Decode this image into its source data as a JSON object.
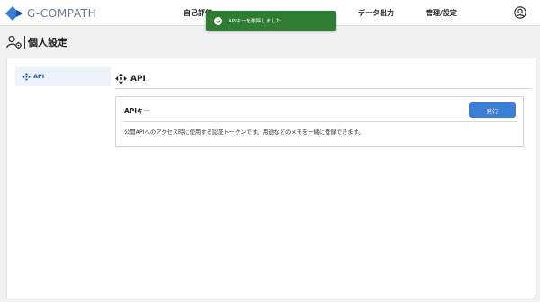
{
  "app": {
    "logo_text": "G-COMPATH"
  },
  "nav": {
    "items": [
      {
        "label": "自己評価"
      },
      {
        "label": "データ出力"
      },
      {
        "label": "管理/設定"
      }
    ]
  },
  "toast": {
    "message": "APIキーを削除しました",
    "color": "#2e7d32"
  },
  "page": {
    "title": "個人設定"
  },
  "sidebar": {
    "items": [
      {
        "label": "API",
        "active": true
      }
    ]
  },
  "section": {
    "title": "API"
  },
  "api_key_card": {
    "title": "APIキー",
    "button_label": "発行",
    "description": "公開APIへのアクセス時に使用する認証トークンです。用途などのメモを一緒に登録できます。"
  },
  "colors": {
    "accent": "#3a7fd5",
    "sidebar_active_bg": "#eef3fb"
  }
}
